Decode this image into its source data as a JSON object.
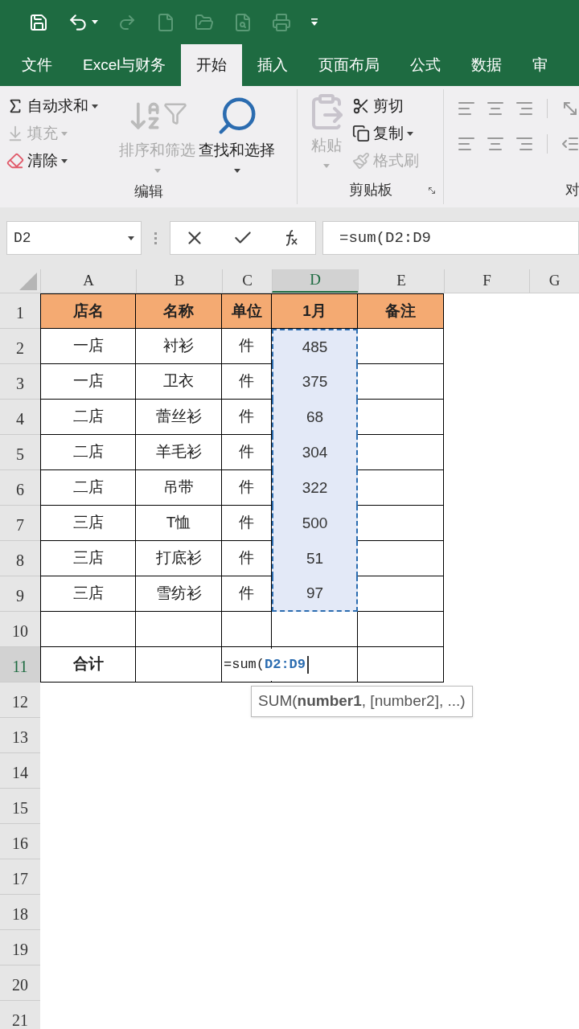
{
  "tabs": [
    {
      "label": "文件",
      "selected": false
    },
    {
      "label": "Excel与财务",
      "selected": false
    },
    {
      "label": "开始",
      "selected": true
    },
    {
      "label": "插入",
      "selected": false
    },
    {
      "label": "页面布局",
      "selected": false
    },
    {
      "label": "公式",
      "selected": false
    },
    {
      "label": "数据",
      "selected": false
    },
    {
      "label": "审",
      "selected": false
    }
  ],
  "ribbon": {
    "editing": {
      "label": "编辑",
      "small": [
        {
          "kind": "sum",
          "label": "自动求和",
          "disabled": false
        },
        {
          "kind": "fill",
          "label": "填充",
          "disabled": true
        },
        {
          "kind": "clear",
          "label": "清除",
          "disabled": false
        }
      ],
      "big": [
        {
          "kind": "sort",
          "label": "排序和筛选",
          "disabled": true
        },
        {
          "kind": "find",
          "label": "查找和选择",
          "disabled": false
        }
      ]
    },
    "clipboard": {
      "label": "剪贴板",
      "paste": {
        "label": "粘贴",
        "disabled": true
      },
      "small": [
        {
          "kind": "cut",
          "label": "剪切",
          "disabled": false
        },
        {
          "kind": "copy",
          "label": "复制",
          "disabled": false
        },
        {
          "kind": "brush",
          "label": "格式刷",
          "disabled": true
        }
      ]
    },
    "align": {
      "label": "对"
    }
  },
  "formula_bar": {
    "name_box": "D2",
    "formula": "=sum(D2:D9"
  },
  "columns": [
    {
      "label": "A",
      "selected": false
    },
    {
      "label": "B",
      "selected": false
    },
    {
      "label": "C",
      "selected": false
    },
    {
      "label": "D",
      "selected": true
    },
    {
      "label": "E",
      "selected": false
    },
    {
      "label": "F",
      "selected": false
    },
    {
      "label": "G",
      "selected": false
    }
  ],
  "rows": [
    {
      "number": "1",
      "selected": false,
      "kind": "header",
      "cells": [
        "店名",
        "名称",
        "单位",
        "1月",
        "备注"
      ],
      "in_range": false
    },
    {
      "number": "2",
      "selected": false,
      "kind": "data",
      "cells": [
        "一店",
        "衬衫",
        "件",
        "485",
        ""
      ],
      "in_range": true
    },
    {
      "number": "3",
      "selected": false,
      "kind": "data",
      "cells": [
        "一店",
        "卫衣",
        "件",
        "375",
        ""
      ],
      "in_range": true
    },
    {
      "number": "4",
      "selected": false,
      "kind": "data",
      "cells": [
        "二店",
        "蕾丝衫",
        "件",
        "68",
        ""
      ],
      "in_range": true
    },
    {
      "number": "5",
      "selected": false,
      "kind": "data",
      "cells": [
        "二店",
        "羊毛衫",
        "件",
        "304",
        ""
      ],
      "in_range": true
    },
    {
      "number": "6",
      "selected": false,
      "kind": "data",
      "cells": [
        "二店",
        "吊带",
        "件",
        "322",
        ""
      ],
      "in_range": true
    },
    {
      "number": "7",
      "selected": false,
      "kind": "data",
      "cells": [
        "三店",
        "T恤",
        "件",
        "500",
        ""
      ],
      "in_range": true
    },
    {
      "number": "8",
      "selected": false,
      "kind": "data",
      "cells": [
        "三店",
        "打底衫",
        "件",
        "51",
        ""
      ],
      "in_range": true
    },
    {
      "number": "9",
      "selected": false,
      "kind": "data",
      "cells": [
        "三店",
        "雪纺衫",
        "件",
        "97",
        ""
      ],
      "in_range": true
    },
    {
      "number": "10",
      "selected": false,
      "kind": "data",
      "cells": [
        "",
        "",
        "",
        "",
        ""
      ],
      "in_range": false
    },
    {
      "number": "11",
      "selected": true,
      "kind": "total",
      "cells": [
        "合计",
        "",
        "",
        "",
        ""
      ],
      "in_range": false,
      "editing": {
        "prefix": "=sum(",
        "reference": "D2:D9"
      }
    },
    {
      "number": "12",
      "selected": false,
      "kind": "empty"
    },
    {
      "number": "13",
      "selected": false,
      "kind": "empty"
    },
    {
      "number": "14",
      "selected": false,
      "kind": "empty"
    },
    {
      "number": "15",
      "selected": false,
      "kind": "empty"
    },
    {
      "number": "16",
      "selected": false,
      "kind": "empty"
    },
    {
      "number": "17",
      "selected": false,
      "kind": "empty"
    },
    {
      "number": "18",
      "selected": false,
      "kind": "empty"
    },
    {
      "number": "19",
      "selected": false,
      "kind": "empty"
    },
    {
      "number": "20",
      "selected": false,
      "kind": "empty"
    },
    {
      "number": "21",
      "selected": false,
      "kind": "empty"
    }
  ],
  "tooltip": "SUM(**number1**, [number2], ...)"
}
